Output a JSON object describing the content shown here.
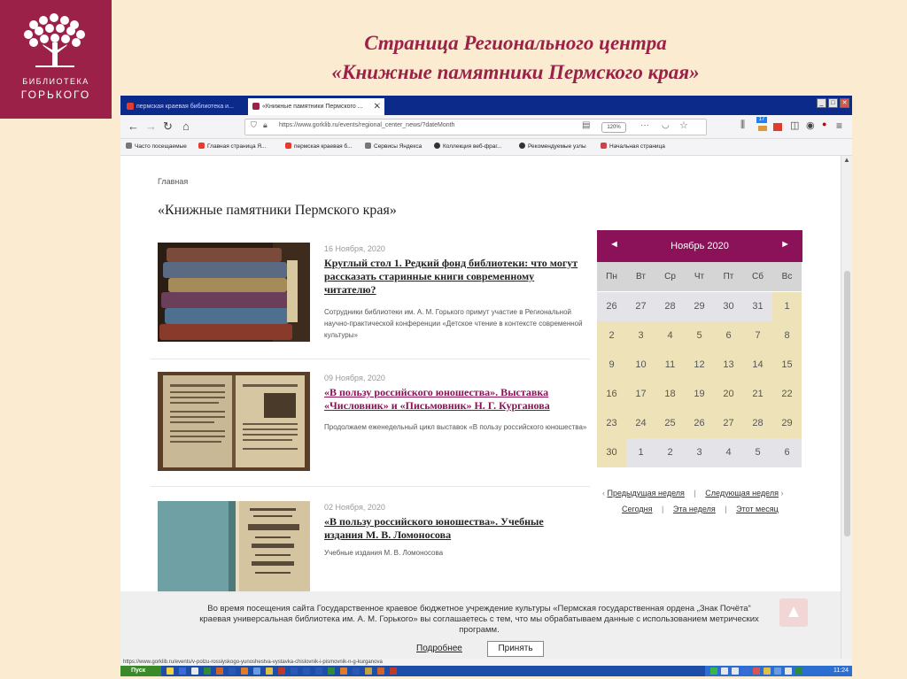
{
  "logo": {
    "line1": "БИБЛИОТЕКА",
    "line2": "ГОРЬКОГО"
  },
  "slide": {
    "title_line1": "Страница Регионального центра",
    "title_line2": "«Книжные памятники Пермского края»"
  },
  "browser": {
    "tabs": [
      {
        "label": "пермская краевая библиотека и...",
        "active": false,
        "close": "✕"
      },
      {
        "label": "«Книжные памятники Пермского ...",
        "active": true,
        "close": "✕"
      }
    ],
    "new_tab": "+",
    "window_controls": [
      "_",
      "□",
      "✕"
    ],
    "url": "https://www.gorklib.ru/events/regional_center_news/?dateMonth",
    "zoom": "120%",
    "bookmarks": [
      "Часто посещаемые",
      "Главная страница Я...",
      "пермская краевая б...",
      "Сервисы Яндекса",
      "Коллекция веб-фраг...",
      "Рекомендуемые узлы",
      "Начальная страница"
    ],
    "library_badge": "17",
    "status_url": "https://www.gorklib.ru/events/v-polzu-rossiyskogo-yunoshestva-vystavka-chislovnik-i-pismovnik-n-g-kurganova"
  },
  "page": {
    "breadcrumb": "Главная",
    "title": "«Книжные памятники Пермского края»",
    "news": [
      {
        "date": "16 Ноября, 2020",
        "title": "Круглый стол 1. Редкий фонд библиотеки: что могут рассказать старинные книги современному читателю?",
        "desc": "Сотрудники библиотеки им. А. М. Горького примут участие в Региональной научно-практической конференции «Детское чтение в контексте современной культуры»"
      },
      {
        "date": "09 Ноября, 2020",
        "title": "«В пользу российского юношества». Выставка «Числовник» и «Письмовник» Н. Г. Курганова",
        "desc": "Продолжаем еженедельный цикл выставок «В пользу российского юношества»"
      },
      {
        "date": "02 Ноября, 2020",
        "title": "«В пользу российского юношества». Учебные издания М. В. Ломоносова",
        "desc": "Учебные издания М. В. Ломоносова"
      }
    ]
  },
  "calendar": {
    "month": "Ноябрь 2020",
    "prev": "◄",
    "next": "►",
    "weekdays": [
      "Пн",
      "Вт",
      "Ср",
      "Чт",
      "Пт",
      "Сб",
      "Вс"
    ],
    "days": [
      [
        "26",
        "27",
        "28",
        "29",
        "30",
        "31",
        "1"
      ],
      [
        "2",
        "3",
        "4",
        "5",
        "6",
        "7",
        "8"
      ],
      [
        "9",
        "10",
        "11",
        "12",
        "13",
        "14",
        "15"
      ],
      [
        "16",
        "17",
        "18",
        "19",
        "20",
        "21",
        "22"
      ],
      [
        "23",
        "24",
        "25",
        "26",
        "27",
        "28",
        "29"
      ],
      [
        "30",
        "1",
        "2",
        "3",
        "4",
        "5",
        "6"
      ]
    ],
    "prev_week": "Предыдущая неделя",
    "next_week": "Следующая неделя",
    "today": "Сегодня",
    "this_week": "Эта неделя",
    "this_month": "Этот месяц"
  },
  "cookie": {
    "text": "Во время посещения сайта Государственное краевое бюджетное учреждение культуры «Пермская государственная ордена „Знак Почёта“ краевая универсальная библиотека им. А. М. Горького» вы соглашаетесь с тем, что мы обрабатываем данные с использованием метрических программ.",
    "more": "Подробнее",
    "accept": "Принять"
  },
  "taskbar": {
    "start": "Пуск",
    "clock": "11:24"
  }
}
